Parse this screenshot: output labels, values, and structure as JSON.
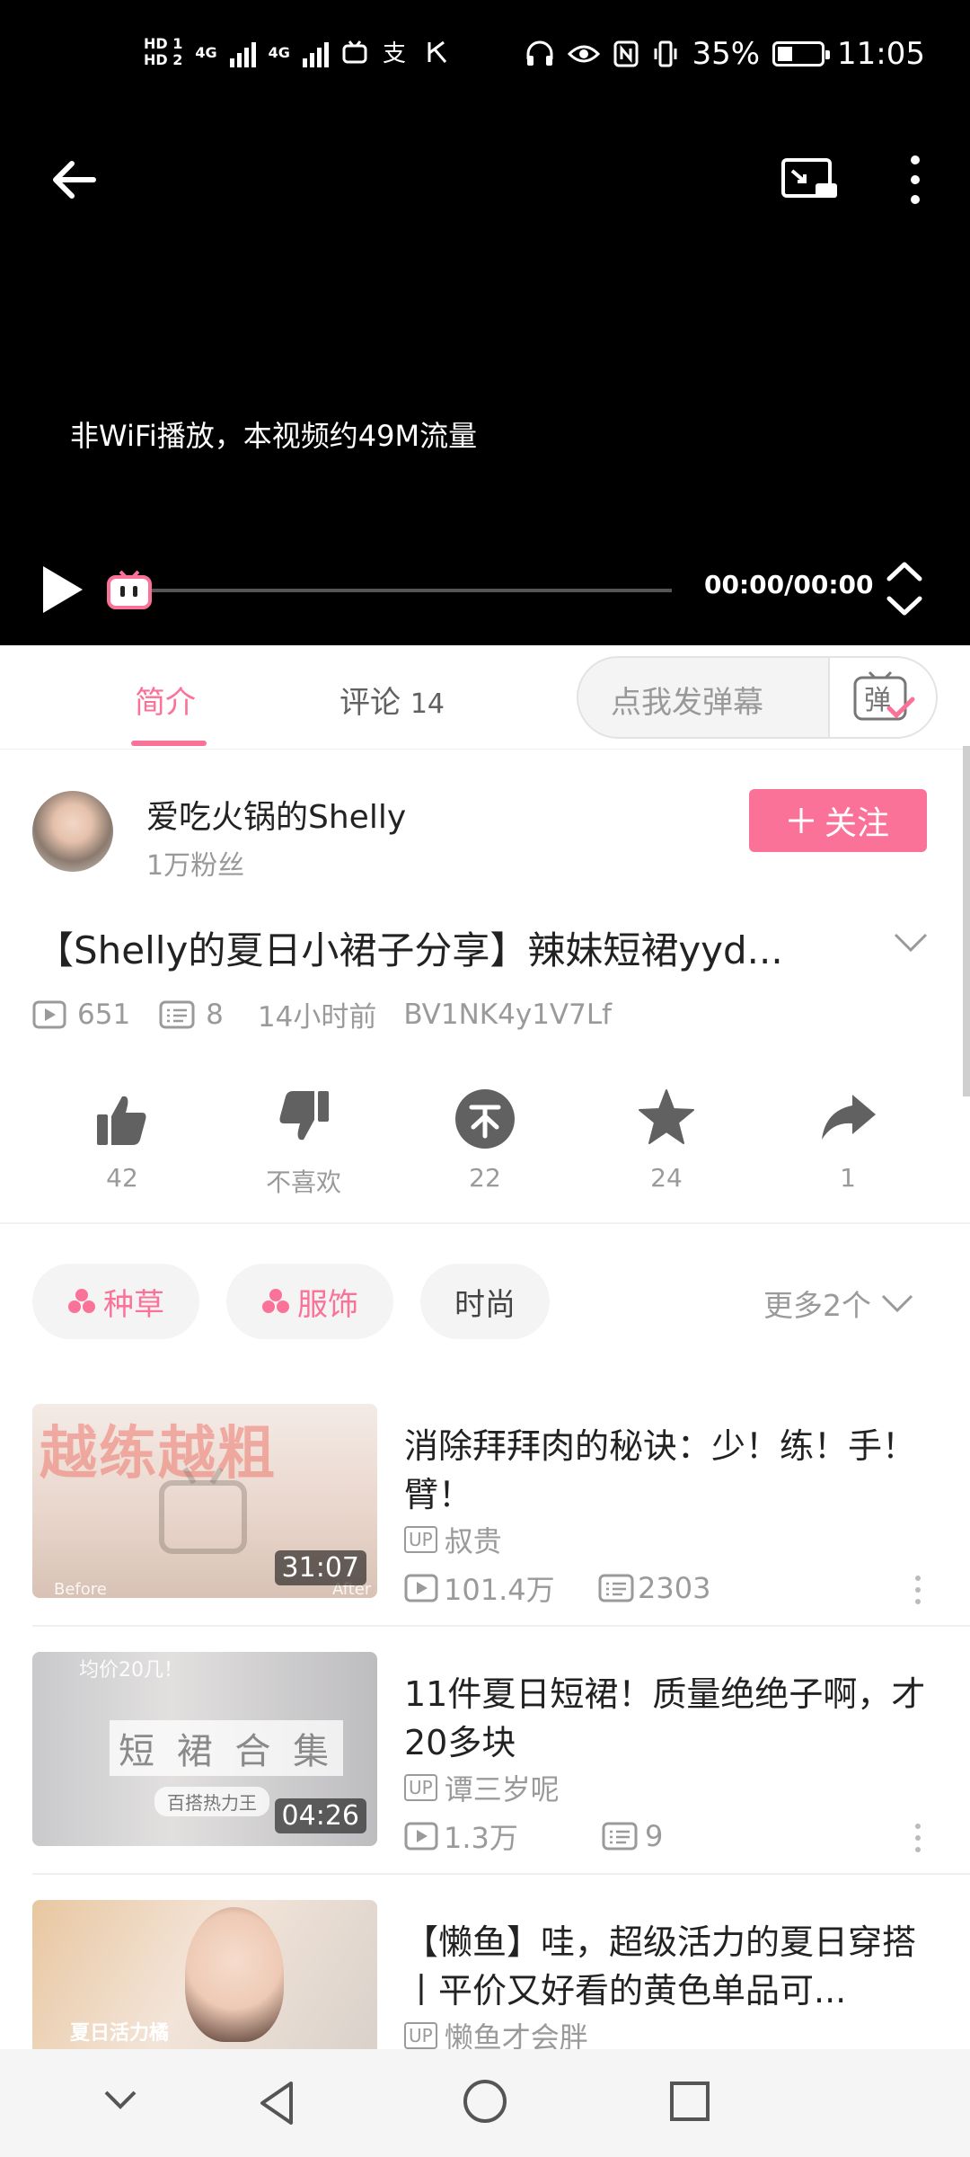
{
  "status_bar": {
    "hd1": "HD 1",
    "hd2": "HD 2",
    "net1": "4G",
    "net2": "4G",
    "battery_percent": "35%",
    "battery_level": 0.35,
    "time": "11:05"
  },
  "player": {
    "notice": "非WiFi播放，本视频约49M流量",
    "timecode": "00:00/00:00"
  },
  "tabs": {
    "intro": "简介",
    "comments_label": "评论",
    "comments_count": "14",
    "danmu_placeholder": "点我发弹幕",
    "danmu_button_char": "弹"
  },
  "uploader": {
    "name": "爱吃火锅的Shelly",
    "fans": "1万粉丝",
    "follow_label": "关注"
  },
  "video": {
    "title": "【Shelly的夏日小裙子分享】辣妹短裙yyd...",
    "views": "651",
    "danmaku": "8",
    "time_ago": "14小时前",
    "bvid": "BV1NK4y1V7Lf"
  },
  "actions": {
    "like": "42",
    "dislike": "不喜欢",
    "coin": "22",
    "favorite": "24",
    "share": "1"
  },
  "tags": {
    "items": [
      "种草",
      "服饰",
      "时尚"
    ],
    "more": "更多2个"
  },
  "recommendations": [
    {
      "title": "消除拜拜肉的秘诀：少！练！手！臂！",
      "up_badge": "UP",
      "uploader": "叔贵",
      "views": "101.4万",
      "danmaku": "2303",
      "duration": "31:07",
      "thumb_text": "越练越粗",
      "thumb_before": "Before",
      "thumb_after": "After"
    },
    {
      "title": "11件夏日短裙！质量绝绝子啊，才20多块",
      "up_badge": "UP",
      "uploader": "谭三岁呢",
      "views": "1.3万",
      "danmaku": "9",
      "duration": "04:26",
      "thumb_text": "短 裙 合 集",
      "thumb_sub": "均价20几！",
      "thumb_banner": "百搭热力王"
    },
    {
      "title": "【懒鱼】哇，超级活力的夏日穿搭丨平价又好看的黄色单品可...",
      "up_badge": "UP",
      "uploader": "懒鱼才会胖",
      "thumb_text": "夏日活力橘"
    }
  ],
  "colors": {
    "accent": "#fb7299",
    "muted": "#9a9a9a"
  }
}
